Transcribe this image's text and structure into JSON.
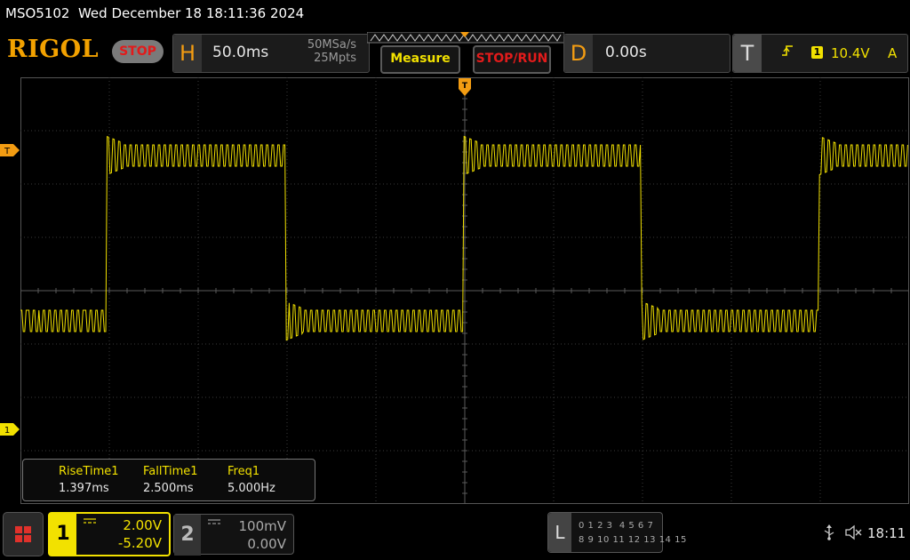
{
  "status_line": "MSO5102  Wed December 18 18:11:36 2024",
  "logo": "RIGOL",
  "run_state": "STOP",
  "horizontal": {
    "letter": "H",
    "timebase": "50.0ms",
    "sample_rate": "50MSa/s",
    "memory_depth": "25Mpts"
  },
  "buttons": {
    "measure": "Measure",
    "stop_run": "STOP/RUN"
  },
  "delay": {
    "letter": "D",
    "value": "0.00s"
  },
  "trigger": {
    "letter": "T",
    "edge_icon": "rising-edge-icon",
    "source": "1",
    "level": "10.4V",
    "mode": "A"
  },
  "markers": {
    "trigger_level": "T",
    "channel1": "1"
  },
  "measurements": [
    {
      "name": "RiseTime1",
      "value": "1.397ms"
    },
    {
      "name": "FallTime1",
      "value": "2.500ms"
    },
    {
      "name": "Freq1",
      "value": "5.000Hz"
    }
  ],
  "channel1": {
    "number": "1",
    "scale": "2.00V",
    "offset": "-5.20V",
    "color": "#f2e100"
  },
  "channel2": {
    "number": "2",
    "scale": "100mV",
    "offset": "0.00V"
  },
  "logic_analyzer": {
    "letter": "L",
    "row1": "0 1 2 3  4 5 6 7",
    "row2": "8 9 10 11 12 13 14 15"
  },
  "clock": "18:11",
  "colors": {
    "accent_orange": "#f39c12",
    "trace_yellow": "#f2e100",
    "stop_red": "#e21b1b",
    "grid": "#3a3a3a"
  }
}
